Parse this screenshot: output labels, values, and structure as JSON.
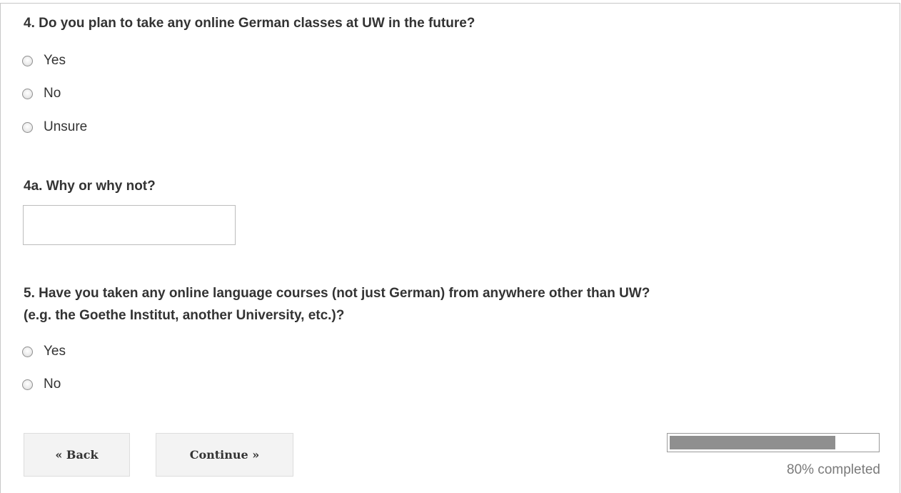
{
  "questions": [
    {
      "title": "4. Do you plan to take any online German classes at UW in the future?",
      "options": [
        "Yes",
        "No",
        "Unsure"
      ]
    },
    {
      "title": "4a. Why or why not?",
      "answer_value": ""
    },
    {
      "title_line1": "5. Have you taken any online language courses (not just German) from anywhere other than UW?",
      "title_line2": "(e.g. the Goethe Institut, another University, etc.)?",
      "options": [
        "Yes",
        "No"
      ]
    }
  ],
  "navigation": {
    "back_label": "« Back",
    "continue_label": "Continue »"
  },
  "progress": {
    "percent": 80,
    "label": "80% completed",
    "fill_color": "#8f8f8f"
  }
}
